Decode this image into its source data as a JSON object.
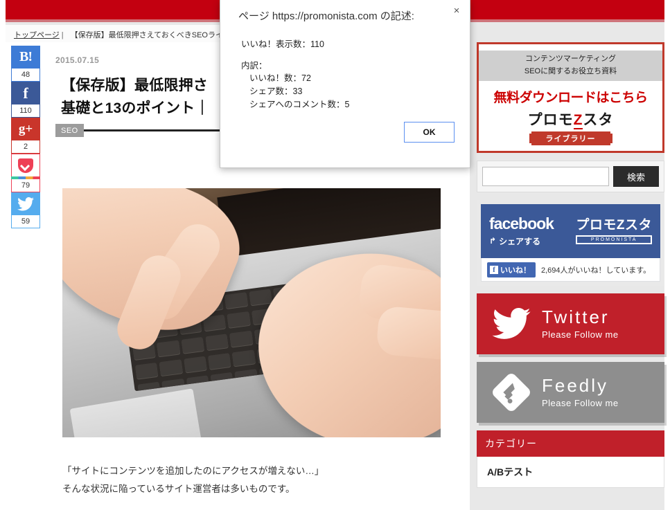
{
  "header": {
    "bar_color": "#c30010"
  },
  "breadcrumb": {
    "home_label": "トップページ",
    "separator": "|",
    "current_label": "【保存版】最低限押さえておくべきSEOライティ"
  },
  "social_rail": {
    "items": [
      {
        "name": "hatena",
        "glyph": "B!",
        "count": "48",
        "color": "#3d7bd6"
      },
      {
        "name": "facebook",
        "glyph": "f",
        "count": "110",
        "color": "#3b5998"
      },
      {
        "name": "google-plus",
        "glyph": "g+",
        "count": "2",
        "color": "#c9352b"
      },
      {
        "name": "pocket",
        "glyph": "",
        "count": "79",
        "color": "#ee4056"
      },
      {
        "name": "twitter",
        "glyph": "🐦",
        "count": "59",
        "color": "#55acee"
      }
    ]
  },
  "article": {
    "date": "2015.07.15",
    "title_line1": "【保存版】最低限押さ",
    "title_line2": "基礎と13のポイント｜",
    "tag": "SEO",
    "body_line1": "「サイトにコンテンツを追加したのにアクセスが増えない…」",
    "body_line2": "そんな状況に陥っているサイト運営者は多いものです。"
  },
  "sidebar": {
    "ad": {
      "sub_line1": "コンテンツマーケティング",
      "sub_line2": "SEOに関するお役立ち資料",
      "main": "無料ダウンロードはこちら",
      "logo_pre": "プロモ",
      "logo_z": "Z",
      "logo_post": "スタ",
      "library": "ライブラリー"
    },
    "search": {
      "value": "",
      "placeholder": "",
      "button_label": "検索"
    },
    "facebook": {
      "word": "facebook",
      "share_label": "シェアする",
      "brand": "プロモZスタ",
      "brand_sub": "PROMONISTA",
      "like_button": "いいね！",
      "like_count": "2,694人がいいね！しています。"
    },
    "twitter_banner": {
      "title": "Twitter",
      "subtitle": "Please Follow me",
      "color": "#c0202a"
    },
    "feedly_banner": {
      "title": "Feedly",
      "subtitle": "Please Follow me",
      "color": "#8e8e8e"
    },
    "categories": {
      "heading": "カテゴリー",
      "items": [
        "A/Bテスト"
      ]
    }
  },
  "dialog": {
    "title": "ページ https://promonista.com の記述:",
    "close_label": "×",
    "line_total": "いいね！表示数：110",
    "breakdown_label": "内訳：",
    "breakdown": [
      "いいね！数：72",
      "シェア数：33",
      "シェアへのコメント数：5"
    ],
    "ok_label": "OK"
  }
}
